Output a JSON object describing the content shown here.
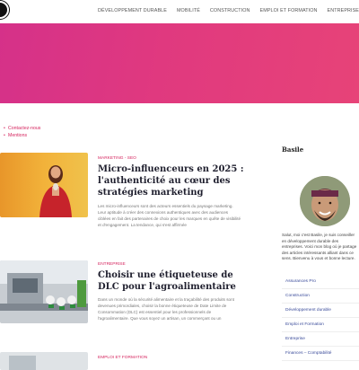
{
  "nav": {
    "items": [
      "DÉVELOPPEMENT DURABLE",
      "MOBILITÉ",
      "CONSTRUCTION",
      "EMPLOI ET FORMATION",
      "ENTREPRISE"
    ]
  },
  "top_links": [
    "Contactez-nous",
    "Mentions"
  ],
  "posts": [
    {
      "category": "MARKETING - SEO",
      "title": "Micro-influenceurs en 2025 : l'authenticité au cœur des stratégies marketing",
      "excerpt": "Les micro-influenceurs sont des acteurs essentiels du paysage marketing. Leur aptitude à créer des connexions authentiques avec des audiences ciblées en fait des partenaires de choix pour les marques en quête de visibilité et d'engagement. La tendance, qui s'est affirmée"
    },
    {
      "category": "ENTREPRISE",
      "title": "Choisir une étiqueteuse de DLC pour l'agroalimentaire",
      "excerpt": "Dans un monde où la sécurité alimentaire et la traçabilité des produits sont devenues primordiales, choisir la bonne étiqueteuse de Date Limite de Consommation (DLC) est essentiel pour les professionnels de l'agroalimentaire. Que vous soyez un artisan, un commerçant ou un"
    },
    {
      "category": "EMPLOI ET FORMATION",
      "title": "",
      "excerpt": ""
    }
  ],
  "sidebar": {
    "author_name": "Basile",
    "bio": "Salut, moi c'est Basile, je suis conseiller en développement durable des entreprises. Voici mon blog où je partage des articles intéressants alliant dans ce sens. Bienvenu à vous et bonne lecture.",
    "categories": [
      "Assurances Pro",
      "Construction",
      "Développement durable",
      "Emploi et Formation",
      "Entreprise",
      "Finances – Comptabilité"
    ]
  },
  "colors": {
    "accent": "#d5245e",
    "hero_start": "#d53189",
    "hero_end": "#e74378",
    "link": "#3a4b9a"
  }
}
